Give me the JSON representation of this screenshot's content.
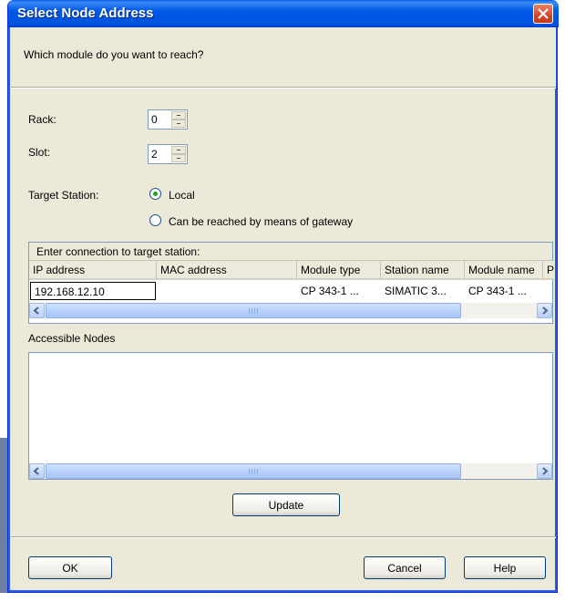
{
  "window": {
    "title": "Select Node Address"
  },
  "header": {
    "question": "Which module do you want to reach?"
  },
  "rack": {
    "label": "Rack:",
    "value": "0"
  },
  "slot": {
    "label": "Slot:",
    "value": "2"
  },
  "target_station": {
    "label": "Target Station:",
    "options": [
      {
        "label": "Local",
        "selected": true
      },
      {
        "label": "Can be reached by means of gateway",
        "selected": false
      }
    ]
  },
  "connection_table": {
    "caption": "Enter connection to target station:",
    "columns": [
      "IP address",
      "MAC address",
      "Module type",
      "Station name",
      "Module name",
      "P"
    ],
    "rows": [
      [
        "192.168.12.10",
        "",
        "CP 343-1 ...",
        "SIMATIC 3...",
        "CP 343-1 ...",
        ""
      ]
    ]
  },
  "accessible_nodes": {
    "label": "Accessible Nodes"
  },
  "buttons": {
    "update": "Update",
    "ok": "OK",
    "cancel": "Cancel",
    "help": "Help"
  },
  "icons": {
    "close": "close-icon",
    "spin": "spin-arrows-icon",
    "scroll_left": "chevron-left-icon",
    "scroll_right": "chevron-right-icon"
  },
  "colors": {
    "titlebar": "#0058e6",
    "dialog_bg": "#ece9d8",
    "close_button": "#d4462a"
  }
}
